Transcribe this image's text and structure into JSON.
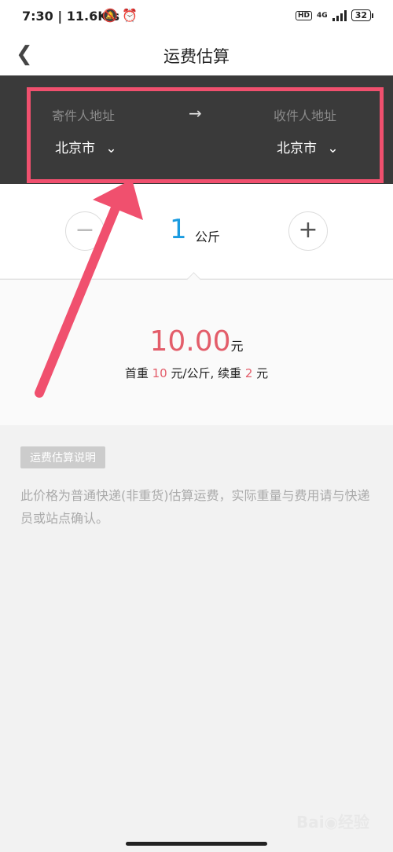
{
  "status_bar": {
    "time": "7:30",
    "speed": "11.6K/s",
    "net": "4G",
    "hd": "HD",
    "battery": "32"
  },
  "header": {
    "title": "运费估算"
  },
  "address": {
    "sender_label": "寄件人地址",
    "sender_city": "北京市",
    "receiver_label": "收件人地址",
    "receiver_city": "北京市",
    "arrow": "→"
  },
  "weight": {
    "value": "1",
    "unit": "公斤",
    "minus": "−",
    "plus": "+"
  },
  "price": {
    "amount": "10.00",
    "currency": "元",
    "rate_prefix": "首重 ",
    "first_weight": "10",
    "rate_mid": " 元/公斤, 续重 ",
    "extra_weight": "2",
    "rate_suffix": " 元"
  },
  "note": {
    "badge": "运费估算说明",
    "text": "此价格为普通快递(非重货)估算运费，实际重量与费用请与快递员或站点确认。"
  },
  "watermark": "Bai 经验",
  "colors": {
    "accent_red": "#e35d6a",
    "weight_blue": "#1a9be0",
    "highlight": "#f0506e",
    "panel": "#3a3a3a"
  }
}
